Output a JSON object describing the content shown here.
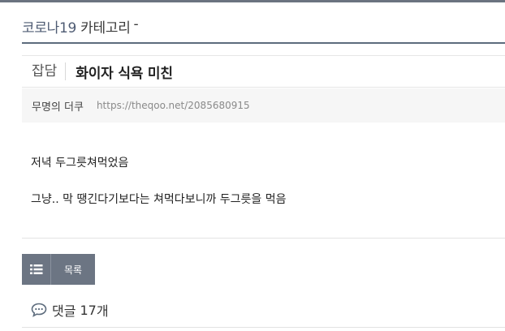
{
  "header": {
    "category": "코로나19",
    "category_suffix": "카테고리",
    "separator": "-"
  },
  "post": {
    "board": "잡담",
    "title": "화이자 식욕 미친",
    "author": "무명의 더쿠",
    "url": "https://theqoo.net/2085680915",
    "body": [
      "저녁 두그릇쳐먹었음",
      "그냥.. 막 땡긴다기보다는 쳐먹다보니까 두그릇을 먹음"
    ]
  },
  "actions": {
    "list_label": "목록",
    "list_icon": "list-icon"
  },
  "comments": {
    "label": "댓글",
    "count": "17",
    "unit": "개",
    "icon": "speech-bubble-icon"
  },
  "colors": {
    "accent": "#5d6c7d",
    "button_bg": "#6c7583",
    "meta_bg": "#f6f6f6"
  }
}
